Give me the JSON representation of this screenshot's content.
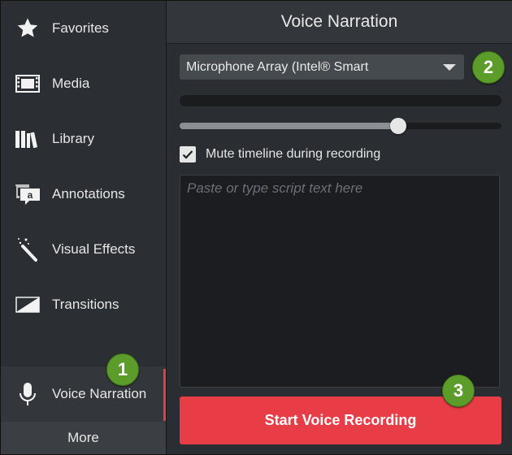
{
  "sidebar": {
    "items": [
      {
        "label": "Favorites",
        "icon": "star-icon"
      },
      {
        "label": "Media",
        "icon": "film-icon"
      },
      {
        "label": "Library",
        "icon": "library-icon"
      },
      {
        "label": "Annotations",
        "icon": "annotation-icon"
      },
      {
        "label": "Visual Effects",
        "icon": "magic-wand-icon"
      },
      {
        "label": "Transitions",
        "icon": "transition-icon"
      },
      {
        "label": "Voice Narration",
        "icon": "microphone-icon"
      }
    ],
    "active": "Voice Narration",
    "more_label": "More"
  },
  "panel": {
    "title": "Voice Narration",
    "device": "Microphone Array (Intel® Smart",
    "volume_level": 0.68,
    "mute_label": "Mute timeline during recording",
    "mute_checked": true,
    "script_placeholder": "Paste or type script text here",
    "record_label": "Start Voice Recording"
  },
  "callouts": [
    "1",
    "2",
    "3"
  ],
  "colors": {
    "accent_red": "#e83c46",
    "callout_green": "#5c9c2a",
    "sidebar_bg": "#2b2f33",
    "panel_bg": "#2a2e32"
  }
}
